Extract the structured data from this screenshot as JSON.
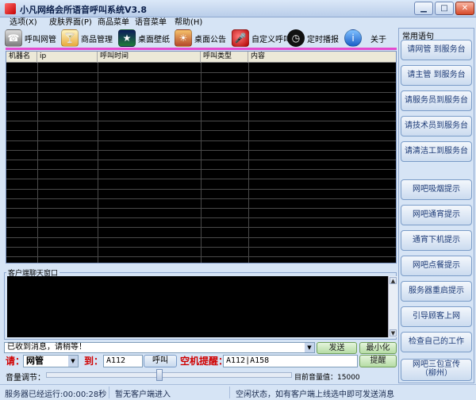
{
  "window": {
    "title": "小凡网络会所语音呼叫系统V3.8",
    "min": "▁",
    "max": "□",
    "close": "✕"
  },
  "menu": [
    "选项(X)",
    "皮肤界面(P)",
    "商品菜单",
    "语音菜单",
    "帮助(H)"
  ],
  "toolbar": [
    {
      "label": "呼叫网管",
      "icon": "pager-icon"
    },
    {
      "label": "商品管理",
      "icon": "cocktail-icon"
    },
    {
      "label": "桌面壁纸",
      "icon": "wallpaper-icon"
    },
    {
      "label": "桌面公告",
      "icon": "sunset-icon"
    },
    {
      "label": "自定义呼叫",
      "icon": "microphone-icon"
    },
    {
      "label": "定时播报",
      "icon": "clock-icon"
    },
    {
      "label": "关于",
      "icon": "info-icon"
    }
  ],
  "grid": {
    "columns": [
      "机器名",
      "ip",
      "呼叫时间",
      "呼叫类型",
      "内容"
    ]
  },
  "chat": {
    "legend": "客户端聊天窗口"
  },
  "message": {
    "value": "已收到消息，请稍等！",
    "send": "发送",
    "minimize": "最小化"
  },
  "call": {
    "please_label": "请：",
    "role_value": "网管",
    "to_label": "到：",
    "to_value": "A112",
    "call_btn": "呼叫",
    "reminder_label": "空机提醒：",
    "reminder_value": "A112|A158",
    "remind_btn": "提醒"
  },
  "volume": {
    "label": "音量调节：",
    "current_label": "目前音量值：",
    "current_value": "15000",
    "level_fraction": 0.46
  },
  "status": {
    "uptime": "服务器已经运行:00:00:28秒",
    "client": "暂无客户端进入",
    "state": "空闲状态，如有客户端上线选中即可发送消息"
  },
  "sidebar": {
    "title": "常用语句",
    "buttons": [
      {
        "label": "请网管 到服务台"
      },
      {
        "label": "请主管 到服务台"
      },
      {
        "label": "请服务员到服务台"
      },
      {
        "label": "请技术员到服务台"
      },
      {
        "label": "请清洁工到服务台"
      },
      {
        "label": "网吧吸烟提示"
      },
      {
        "label": "网吧通宵提示"
      },
      {
        "label": "通宵下机提示"
      },
      {
        "label": "网吧点餐提示"
      },
      {
        "label": "服务器重启提示"
      },
      {
        "label": "引导顾客上网"
      },
      {
        "label": "检查自己的工作"
      },
      {
        "label": "网吧三包宣传",
        "line2": "（柳州）"
      }
    ]
  }
}
